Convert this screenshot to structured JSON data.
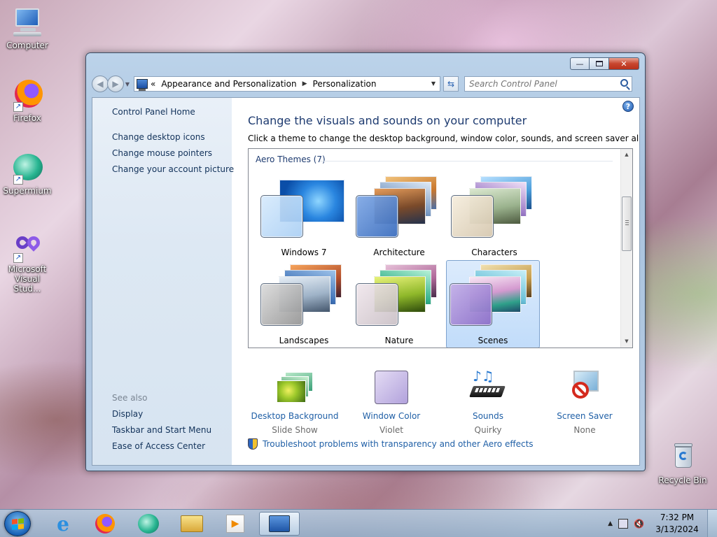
{
  "desktop": {
    "icons": [
      {
        "label": "Computer",
        "icon": "computer-icon"
      },
      {
        "label": "Firefox",
        "icon": "firefox-icon"
      },
      {
        "label": "Supermium",
        "icon": "supermium-icon"
      },
      {
        "label": "Microsoft Visual Stud...",
        "icon": "visual-studio-icon"
      },
      {
        "label": "Recycle Bin",
        "icon": "recycle-bin-icon"
      }
    ]
  },
  "window": {
    "address": {
      "overflow": "«",
      "crumbs": [
        "Appearance and Personalization",
        "Personalization"
      ]
    },
    "search": {
      "placeholder": "Search Control Panel"
    },
    "leftnav": {
      "home": "Control Panel Home",
      "links": [
        "Change desktop icons",
        "Change mouse pointers",
        "Change your account picture"
      ],
      "see_also": "See also",
      "see_also_links": [
        "Display",
        "Taskbar and Start Menu",
        "Ease of Access Center"
      ]
    },
    "main": {
      "title": "Change the visuals and sounds on your computer",
      "subtitle": "Click a theme to change the desktop background, window color, sounds, and screen saver all at once.",
      "group_title": "Aero Themes (7)",
      "themes": [
        {
          "name": "Windows 7",
          "selected": false
        },
        {
          "name": "Architecture",
          "selected": false
        },
        {
          "name": "Characters",
          "selected": false
        },
        {
          "name": "Landscapes",
          "selected": false
        },
        {
          "name": "Nature",
          "selected": false
        },
        {
          "name": "Scenes",
          "selected": true
        }
      ],
      "settings": [
        {
          "label": "Desktop Background",
          "value": "Slide Show"
        },
        {
          "label": "Window Color",
          "value": "Violet"
        },
        {
          "label": "Sounds",
          "value": "Quirky"
        },
        {
          "label": "Screen Saver",
          "value": "None"
        }
      ],
      "troubleshoot": "Troubleshoot problems with transparency and other Aero effects"
    }
  },
  "taskbar": {
    "pinned": [
      "internet-explorer-icon",
      "firefox-icon",
      "supermium-icon",
      "windows-explorer-icon",
      "media-player-icon",
      "control-panel-icon"
    ],
    "time": "7:32 PM",
    "date": "3/13/2024"
  },
  "colors": {
    "link": "#1f5fa6",
    "title": "#1e3b70",
    "selection": "#c1dcfa"
  }
}
